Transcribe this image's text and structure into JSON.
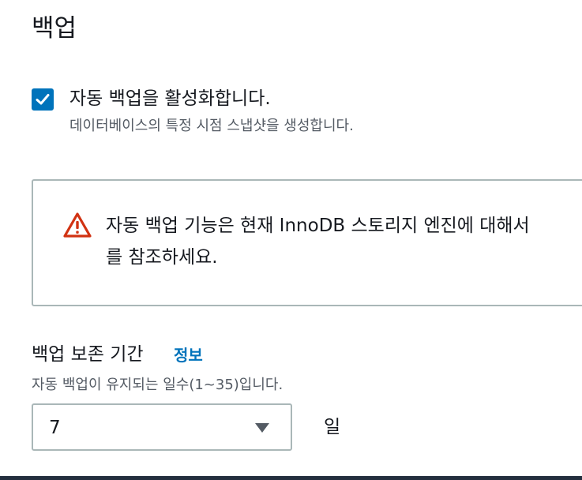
{
  "section": {
    "title": "백업"
  },
  "auto_backup": {
    "checked": true,
    "label": "자동 백업을 활성화합니다.",
    "description": "데이터베이스의 특정 시점 스냅샷을 생성합니다."
  },
  "alert": {
    "type": "warning",
    "icon": "warning-icon",
    "line1": "자동 백업 기능은 현재 InnoDB 스토리지 엔진에 대해서",
    "line2": "를 참조하세요.",
    "color": "#d13212"
  },
  "retention": {
    "label": "백업 보존 기간",
    "info_link": "정보",
    "description": "자동 백업이 유지되는 일수(1~35)입니다.",
    "selected_value": "7",
    "unit": "일"
  },
  "colors": {
    "accent": "#0073bb",
    "text": "#16191f",
    "secondary_text": "#545b64",
    "border": "#aab7b8"
  }
}
